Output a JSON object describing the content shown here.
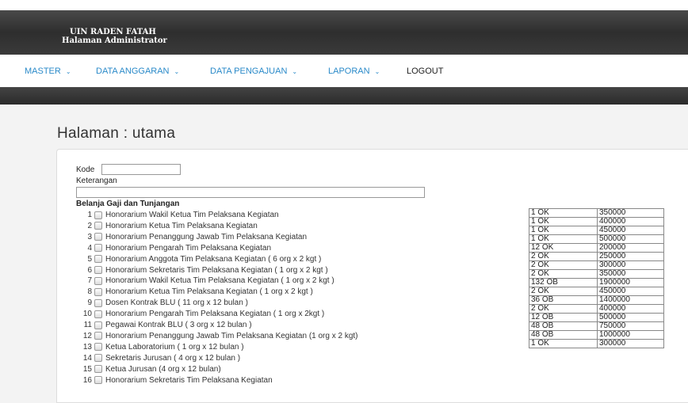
{
  "header": {
    "brand_line1": "UIN RADEN FATAH",
    "brand_line2": "Halaman Administrator"
  },
  "nav": {
    "items": [
      {
        "label": "MASTER"
      },
      {
        "label": "DATA ANGGARAN"
      },
      {
        "label": "DATA PENGAJUAN"
      },
      {
        "label": "LAPORAN"
      },
      {
        "label": "LOGOUT"
      }
    ],
    "caret": "⌄"
  },
  "page": {
    "title": "Halaman : utama"
  },
  "form": {
    "kode_label": "Kode",
    "kode_value": "",
    "keterangan_label": "Keterangan",
    "keterangan_value": "",
    "section_title": "Belanja Gaji dan Tunjangan"
  },
  "items": [
    {
      "num": "1",
      "label": "Honorarium Wakil Ketua Tim Pelaksana Kegiatan",
      "qty": "1 OK",
      "amount": "350000"
    },
    {
      "num": "2",
      "label": "Honorarium Ketua Tim Pelaksana Kegiatan",
      "qty": "1 OK",
      "amount": "400000"
    },
    {
      "num": "3",
      "label": "Honorarium Penanggung Jawab Tim Pelaksana Kegiatan",
      "qty": "1 OK",
      "amount": "450000"
    },
    {
      "num": "4",
      "label": "Honorarium Pengarah Tim Pelaksana Kegiatan",
      "qty": "1 OK",
      "amount": "500000"
    },
    {
      "num": "5",
      "label": "Honorarium Anggota Tim Pelaksana Kegiatan ( 6 org x 2 kgt )",
      "qty": "12 OK",
      "amount": "200000"
    },
    {
      "num": "6",
      "label": "Honorarium Sekretaris Tim Pelaksana Kegiatan ( 1 org x 2 kgt )",
      "qty": "2 OK",
      "amount": "250000"
    },
    {
      "num": "7",
      "label": "Honorarium Wakil Ketua Tim Pelaksana Kegiatan ( 1 org x 2 kgt )",
      "qty": "2 OK",
      "amount": "300000"
    },
    {
      "num": "8",
      "label": "Honorarium Ketua Tim Pelaksana Kegiatan ( 1 org x 2 kgt )",
      "qty": "2 OK",
      "amount": "350000"
    },
    {
      "num": "9",
      "label": "Dosen Kontrak BLU ( 11 org x 12 bulan )",
      "qty": "132 OB",
      "amount": "1900000"
    },
    {
      "num": "10",
      "label": "Honorarium Pengarah Tim Pelaksana Kegiatan ( 1 org x 2kgt )",
      "qty": "2 OK",
      "amount": "450000"
    },
    {
      "num": "11",
      "label": "Pegawai Kontrak BLU ( 3 org x 12 bulan )",
      "qty": "36 OB",
      "amount": "1400000"
    },
    {
      "num": "12",
      "label": "Honorarium Penanggung Jawab Tim Pelaksana Kegiatan (1 org x 2 kgt)",
      "qty": "2 OK",
      "amount": "400000"
    },
    {
      "num": "13",
      "label": "Ketua Laboratorium ( 1 org x 12 bulan )",
      "qty": "12 OB",
      "amount": "500000"
    },
    {
      "num": "14",
      "label": "Sekretaris Jurusan ( 4 org x 12 bulan )",
      "qty": "48 OB",
      "amount": "750000"
    },
    {
      "num": "15",
      "label": "Ketua Jurusan (4 org x 12 bulan)",
      "qty": "48 OB",
      "amount": "1000000"
    },
    {
      "num": "16",
      "label": "Honorarium Sekretaris Tim Pelaksana Kegiatan",
      "qty": "1 OK",
      "amount": "300000"
    }
  ]
}
